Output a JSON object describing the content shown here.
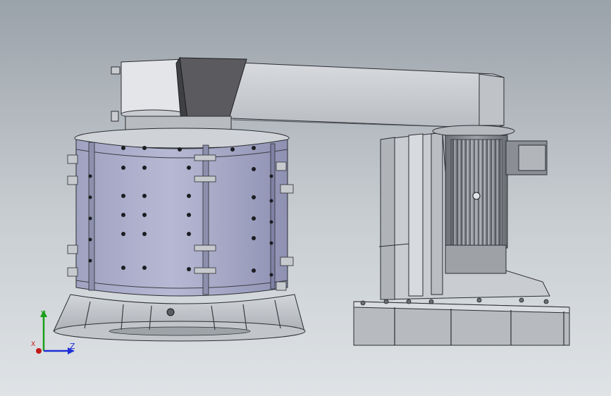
{
  "viewport": {
    "background_top": "#9aa2aa",
    "background_bottom": "#dfe3e6"
  },
  "model": {
    "colors": {
      "body": "#a9abc8",
      "body_shade": "#7d80a3",
      "steel": "#cfd3d7",
      "steel_dark": "#8d9296",
      "hopper": "#5b5b5f",
      "motor": "#7c8086",
      "outline": "#2b2d31"
    }
  },
  "triad": {
    "y_label": "Y",
    "z_label": "Z",
    "x_label": "X",
    "y_color": "#1aa01a",
    "z_color": "#1f2fd8",
    "x_color": "#c21a1a"
  }
}
